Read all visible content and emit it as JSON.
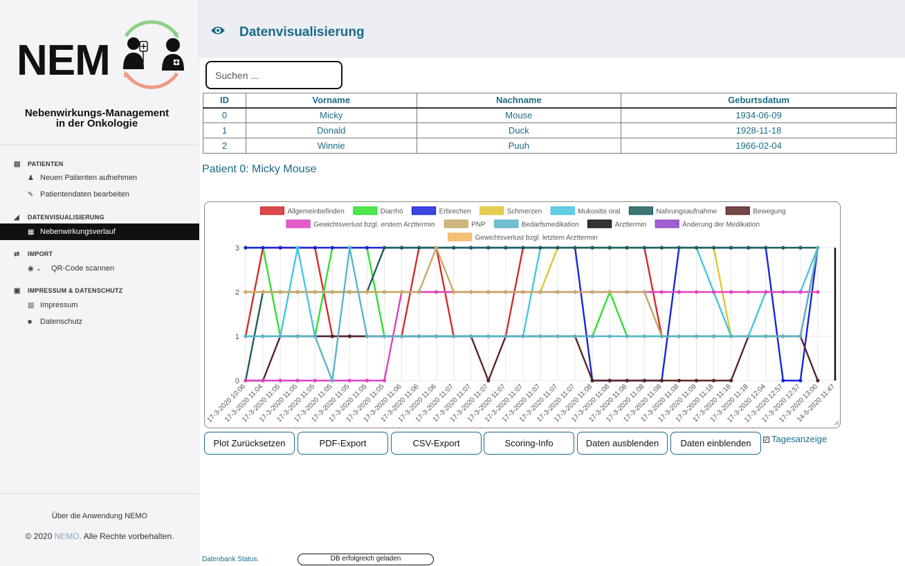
{
  "app": {
    "logo_text": "NEM",
    "subtitle_line1": "Nebenwirkungs-Management",
    "subtitle_line2": "in der Onkologie"
  },
  "sidebar": {
    "sections": [
      {
        "title": "PATIENTEN",
        "icon": "clipboard-icon",
        "items": [
          {
            "label": "Neuen Patienten aufnehmen",
            "icon": "user-plus-icon"
          },
          {
            "label": "Patientendaten bearbeiten",
            "icon": "pencil-icon"
          }
        ]
      },
      {
        "title": "DATENVISUALISIERUNG",
        "icon": "area-chart-icon",
        "items": [
          {
            "label": "Nebenwirkungsverlauf",
            "icon": "table-icon",
            "active": true
          }
        ]
      },
      {
        "title": "IMPORT",
        "icon": "exchange-icon",
        "items": [
          {
            "label": "QR-Code scannen",
            "icon": "camera-icon"
          }
        ]
      },
      {
        "title": "IMPRESSUM & DATENSCHUTZ",
        "icon": "book-icon",
        "items": [
          {
            "label": "Impressum",
            "icon": "id-card-icon"
          },
          {
            "label": "Datenschutz",
            "icon": "lock-icon"
          }
        ]
      }
    ],
    "about": "Über die Anwendung NEMO",
    "copyright_prefix": "© 2020 ",
    "copyright_brand": "NEMO.",
    "copyright_suffix": " Alle Rechte vorbehalten."
  },
  "header": {
    "title": "Datenvisualisierung",
    "icon": "eye-icon"
  },
  "search": {
    "placeholder": "Suchen ..."
  },
  "table": {
    "columns": [
      "ID",
      "Vorname",
      "Nachname",
      "Geburtsdatum"
    ],
    "rows": [
      [
        "0",
        "Micky",
        "Mouse",
        "1934-06-09"
      ],
      [
        "1",
        "Donald",
        "Duck",
        "1928-11-18"
      ],
      [
        "2",
        "Winnie",
        "Puuh",
        "1966-02-04"
      ]
    ]
  },
  "patient_heading": "Patient 0: Micky Mouse",
  "buttons": {
    "reset": "Plot Zurücksetzen",
    "pdf": "PDF-Export",
    "csv": "CSV-Export",
    "scoring": "Scoring-Info",
    "hide": "Daten ausblenden",
    "show": "Daten einblenden"
  },
  "day_toggle": {
    "label": "Tagesanzeige",
    "checked": true
  },
  "status": {
    "label": "Datenbank Status:",
    "value": "DB erfolgreich geladen"
  },
  "chart_data": {
    "type": "line",
    "ylim": [
      0,
      3
    ],
    "yticks": [
      0,
      1,
      2,
      3
    ],
    "x": [
      "17-3-2020 10:06",
      "17-3-2020 11:04",
      "17-3-2020 11:05",
      "17-3-2020 11:05",
      "17-3-2020 11:05",
      "17-3-2020 11:05",
      "17-3-2020 11:05",
      "17-3-2020 11:05",
      "17-3-2020 11:05",
      "17-3-2020 11:06",
      "17-3-2020 11:06",
      "17-3-2020 11:06",
      "17-3-2020 11:07",
      "17-3-2020 11:07",
      "17-3-2020 11:07",
      "17-3-2020 11:07",
      "17-3-2020 11:07",
      "17-3-2020 11:07",
      "17-3-2020 11:07",
      "17-3-2020 11:07",
      "17-3-2020 11:08",
      "17-3-2020 11:08",
      "17-3-2020 11:08",
      "17-3-2020 11:08",
      "17-3-2020 11:08",
      "17-3-2020 11:08",
      "17-3-2020 11:09",
      "17-3-2020 11:18",
      "17-3-2020 11:18",
      "17-3-2020 11:18",
      "17-3-2020 12:04",
      "17-3-2020 12:57",
      "17-3-2020 12:57",
      "17-3-2020 13:00",
      "14-5-2020 11:47"
    ],
    "series": [
      {
        "name": "Allgemeinbefinden",
        "color": "#d42a2a",
        "values": [
          1,
          3,
          3,
          3,
          3,
          1,
          1,
          1,
          1,
          1,
          3,
          3,
          1,
          1,
          1,
          1,
          3,
          3,
          3,
          3,
          3,
          3,
          3,
          3,
          1,
          1,
          1,
          1,
          1,
          1,
          1,
          1,
          1,
          3,
          null
        ]
      },
      {
        "name": "Diarrhö",
        "color": "#2fe02f",
        "values": [
          3,
          3,
          1,
          1,
          1,
          3,
          3,
          3,
          1,
          1,
          1,
          1,
          1,
          1,
          1,
          1,
          1,
          1,
          1,
          1,
          1,
          2,
          1,
          1,
          1,
          1,
          1,
          1,
          1,
          1,
          1,
          1,
          1,
          3,
          null
        ]
      },
      {
        "name": "Erbrechen",
        "color": "#1a24d8",
        "values": [
          3,
          3,
          3,
          3,
          3,
          3,
          3,
          3,
          3,
          3,
          3,
          3,
          3,
          3,
          3,
          3,
          3,
          3,
          3,
          3,
          0,
          0,
          0,
          0,
          0,
          3,
          3,
          3,
          3,
          3,
          3,
          0,
          0,
          3,
          null
        ]
      },
      {
        "name": "Schmerzen",
        "color": "#e0c530",
        "values": [
          2,
          2,
          2,
          2,
          2,
          2,
          2,
          2,
          2,
          2,
          2,
          2,
          2,
          2,
          2,
          2,
          2,
          2,
          3,
          3,
          3,
          3,
          3,
          3,
          3,
          3,
          3,
          3,
          1,
          1,
          1,
          1,
          1,
          3,
          null
        ]
      },
      {
        "name": "Mukositis oral",
        "color": "#45c5e0",
        "values": [
          1,
          1,
          1,
          3,
          1,
          1,
          1,
          1,
          1,
          1,
          1,
          1,
          1,
          1,
          1,
          1,
          1,
          3,
          3,
          3,
          3,
          3,
          3,
          3,
          3,
          3,
          3,
          2,
          1,
          1,
          2,
          2,
          2,
          3,
          null
        ]
      },
      {
        "name": "Nahrungsaufnahme",
        "color": "#1c5e5e",
        "values": [
          0,
          2,
          2,
          2,
          2,
          2,
          2,
          2,
          3,
          3,
          3,
          3,
          3,
          3,
          3,
          3,
          3,
          3,
          3,
          3,
          3,
          3,
          3,
          3,
          3,
          3,
          3,
          3,
          3,
          3,
          3,
          3,
          3,
          3,
          null
        ]
      },
      {
        "name": "Bewegung",
        "color": "#5a2424",
        "values": [
          0,
          0,
          1,
          1,
          1,
          1,
          1,
          1,
          1,
          1,
          1,
          1,
          1,
          1,
          0,
          1,
          1,
          1,
          1,
          1,
          0,
          0,
          0,
          0,
          0,
          0,
          0,
          0,
          0,
          1,
          1,
          1,
          1,
          0,
          null
        ]
      },
      {
        "name": "Gewichtsverlust bzgl. erstem Arzttermin",
        "color": "#e040c0",
        "values": [
          0,
          0,
          0,
          0,
          0,
          0,
          0,
          0,
          0,
          2,
          2,
          2,
          2,
          2,
          2,
          2,
          2,
          2,
          2,
          2,
          2,
          2,
          2,
          2,
          2,
          2,
          2,
          2,
          2,
          2,
          2,
          2,
          2,
          2,
          null
        ]
      },
      {
        "name": "PNP",
        "color": "#c4aa6a",
        "values": [
          2,
          2,
          2,
          2,
          2,
          2,
          2,
          2,
          2,
          2,
          2,
          3,
          2,
          2,
          2,
          2,
          2,
          2,
          2,
          2,
          2,
          2,
          2,
          2,
          1,
          1,
          1,
          1,
          1,
          1,
          1,
          1,
          1,
          3,
          null
        ]
      },
      {
        "name": "Bedarfsmedikation",
        "color": "#5ab4c8",
        "values": [
          1,
          1,
          1,
          1,
          1,
          0,
          3,
          1,
          1,
          1,
          1,
          1,
          1,
          1,
          1,
          1,
          1,
          1,
          1,
          1,
          1,
          1,
          1,
          1,
          1,
          1,
          1,
          1,
          1,
          1,
          1,
          1,
          1,
          3,
          null
        ]
      },
      {
        "name": "Arzttermin",
        "color": "#111111",
        "values": [
          null,
          null,
          null,
          null,
          null,
          null,
          null,
          null,
          null,
          null,
          null,
          null,
          null,
          null,
          null,
          null,
          null,
          null,
          null,
          null,
          null,
          null,
          null,
          null,
          null,
          null,
          null,
          null,
          null,
          null,
          null,
          null,
          null,
          null,
          null
        ]
      },
      {
        "name": "Änderung der Medikation",
        "color": "#8e44c8",
        "values": [
          null,
          null,
          null,
          null,
          null,
          null,
          null,
          null,
          null,
          null,
          null,
          null,
          null,
          null,
          null,
          null,
          null,
          null,
          null,
          null,
          null,
          null,
          null,
          null,
          null,
          null,
          null,
          null,
          null,
          null,
          null,
          null,
          null,
          null,
          null
        ]
      },
      {
        "name": "Gewichtsverlust bzgl. letztem Arzttermin",
        "color": "#f2b560",
        "values": [
          null,
          null,
          null,
          null,
          null,
          null,
          null,
          null,
          null,
          null,
          null,
          null,
          null,
          null,
          null,
          null,
          null,
          null,
          null,
          null,
          null,
          null,
          null,
          null,
          null,
          null,
          null,
          null,
          null,
          null,
          null,
          null,
          null,
          null,
          null
        ]
      }
    ],
    "legend_position": "top",
    "grid": true
  }
}
